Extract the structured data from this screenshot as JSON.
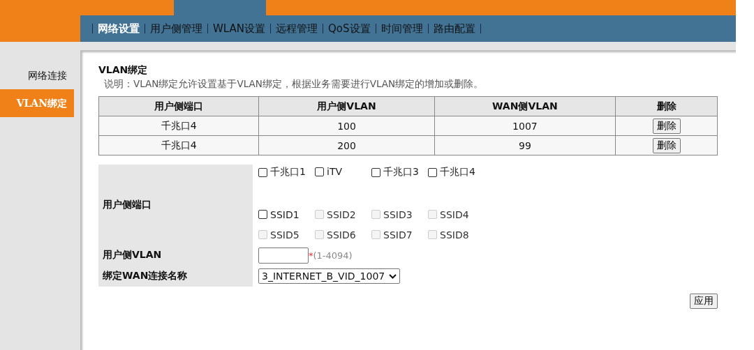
{
  "nav": {
    "items": [
      {
        "label": "网络设置",
        "selected": true
      },
      {
        "label": "用户侧管理",
        "selected": false
      },
      {
        "label": "WLAN设置",
        "selected": false
      },
      {
        "label": "远程管理",
        "selected": false
      },
      {
        "label": "QoS设置",
        "selected": false
      },
      {
        "label": "时间管理",
        "selected": false
      },
      {
        "label": "路由配置",
        "selected": false
      }
    ]
  },
  "sidebar": {
    "items": [
      {
        "label": "网络连接",
        "selected": false
      },
      {
        "label": "VLAN绑定",
        "selected": true
      }
    ]
  },
  "section": {
    "title": "VLAN绑定",
    "description": "说明：VLAN绑定允许设置基于VLAN绑定，根据业务需要进行VLAN绑定的增加或删除。"
  },
  "table": {
    "columns": [
      "用户侧端口",
      "用户侧VLAN",
      "WAN侧VLAN",
      "删除"
    ],
    "rows": [
      {
        "port": "千兆口4",
        "user_vlan": "100",
        "wan_vlan": "1007",
        "action": "删除"
      },
      {
        "port": "千兆口4",
        "user_vlan": "200",
        "wan_vlan": "99",
        "action": "删除"
      }
    ]
  },
  "form": {
    "port_label": "用户侧端口",
    "port_rows": [
      [
        {
          "label": "千兆口1",
          "checked": false,
          "disabled": false
        },
        {
          "label": "iTV",
          "checked": false,
          "disabled": false
        },
        {
          "label": "千兆口3",
          "checked": false,
          "disabled": false
        },
        {
          "label": "千兆口4",
          "checked": false,
          "disabled": false
        }
      ],
      [
        {
          "label": "SSID1",
          "checked": false,
          "disabled": false
        },
        {
          "label": "SSID2",
          "checked": false,
          "disabled": true
        },
        {
          "label": "SSID3",
          "checked": false,
          "disabled": true
        },
        {
          "label": "SSID4",
          "checked": false,
          "disabled": true
        }
      ],
      [
        {
          "label": "SSID5",
          "checked": false,
          "disabled": true
        },
        {
          "label": "SSID6",
          "checked": false,
          "disabled": true
        },
        {
          "label": "SSID7",
          "checked": false,
          "disabled": true
        },
        {
          "label": "SSID8",
          "checked": false,
          "disabled": true
        }
      ]
    ],
    "vlan_label": "用户侧VLAN",
    "vlan_required": "*",
    "vlan_hint": "(1-4094)",
    "wan_label": "绑定WAN连接名称",
    "wan_value": "3_INTERNET_B_VID_1007",
    "apply": "应用"
  }
}
